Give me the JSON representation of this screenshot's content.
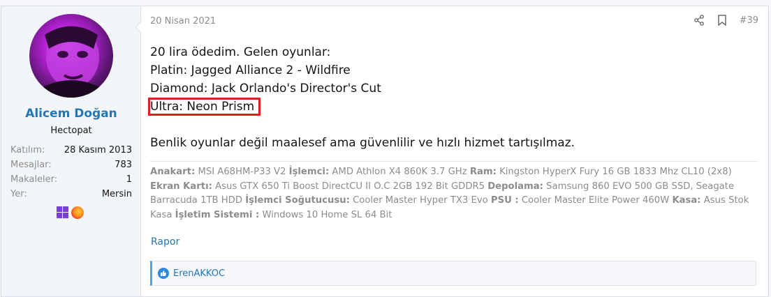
{
  "user": {
    "name": "Alicem Doğan",
    "title": "Hectopat",
    "stats": [
      {
        "label": "Katılım:",
        "value": "28 Kasım 2013"
      },
      {
        "label": "Mesajlar:",
        "value": "783"
      },
      {
        "label": "Makaleler:",
        "value": "1"
      },
      {
        "label": "Yer:",
        "value": "Mersin"
      }
    ],
    "icons": [
      "windows-icon",
      "firefox-icon"
    ]
  },
  "post": {
    "date": "20 Nisan 2021",
    "number": "#39",
    "lines": [
      "20 lira ödedim. Gelen oyunlar:",
      "Platin: Jagged Alliance 2 - Wildfire",
      "Diamond: Jack Orlando's Director's Cut",
      "Ultra: Neon Prism"
    ],
    "closing": "Benlik oyunlar değil maalesef ama güvenlilir ve hızlı hizmet tartışılmaz."
  },
  "signature": [
    {
      "label": "Anakart:",
      "value": " MSI A68HM-P33 V2 "
    },
    {
      "label": "İşlemci:",
      "value": " AMD Athlon X4 860K 3.7 GHz "
    },
    {
      "label": "Ram:",
      "value": " Kingston HyperX Fury 16 GB 1833 Mhz CL10 (2x8) "
    },
    {
      "label": "Ekran Kartı:",
      "value": " Asus GTX 650 Ti Boost DirectCU II O.C 2GB 192 Bit GDDR5 "
    },
    {
      "label": "Depolama:",
      "value": " Samsung 860 EVO 500 GB SSD, Seagate Barracuda 1TB HDD "
    },
    {
      "label": "İşlemci Soğutucusu:",
      "value": " Cooler Master Hyper TX3 Evo "
    },
    {
      "label": "PSU :",
      "value": " Cooler Master Elite Power 460W "
    },
    {
      "label": "Kasa:",
      "value": " Asus Stok Kasa "
    },
    {
      "label": "İşletim Sistemi :",
      "value": " Windows 10 Home SL 64 Bit"
    }
  ],
  "report_label": "Rapor",
  "reactions": {
    "users": "ErenAKKOC"
  },
  "colors": {
    "link": "#2577b1",
    "highlight": "#e02020",
    "muted": "#8c8c8c"
  }
}
